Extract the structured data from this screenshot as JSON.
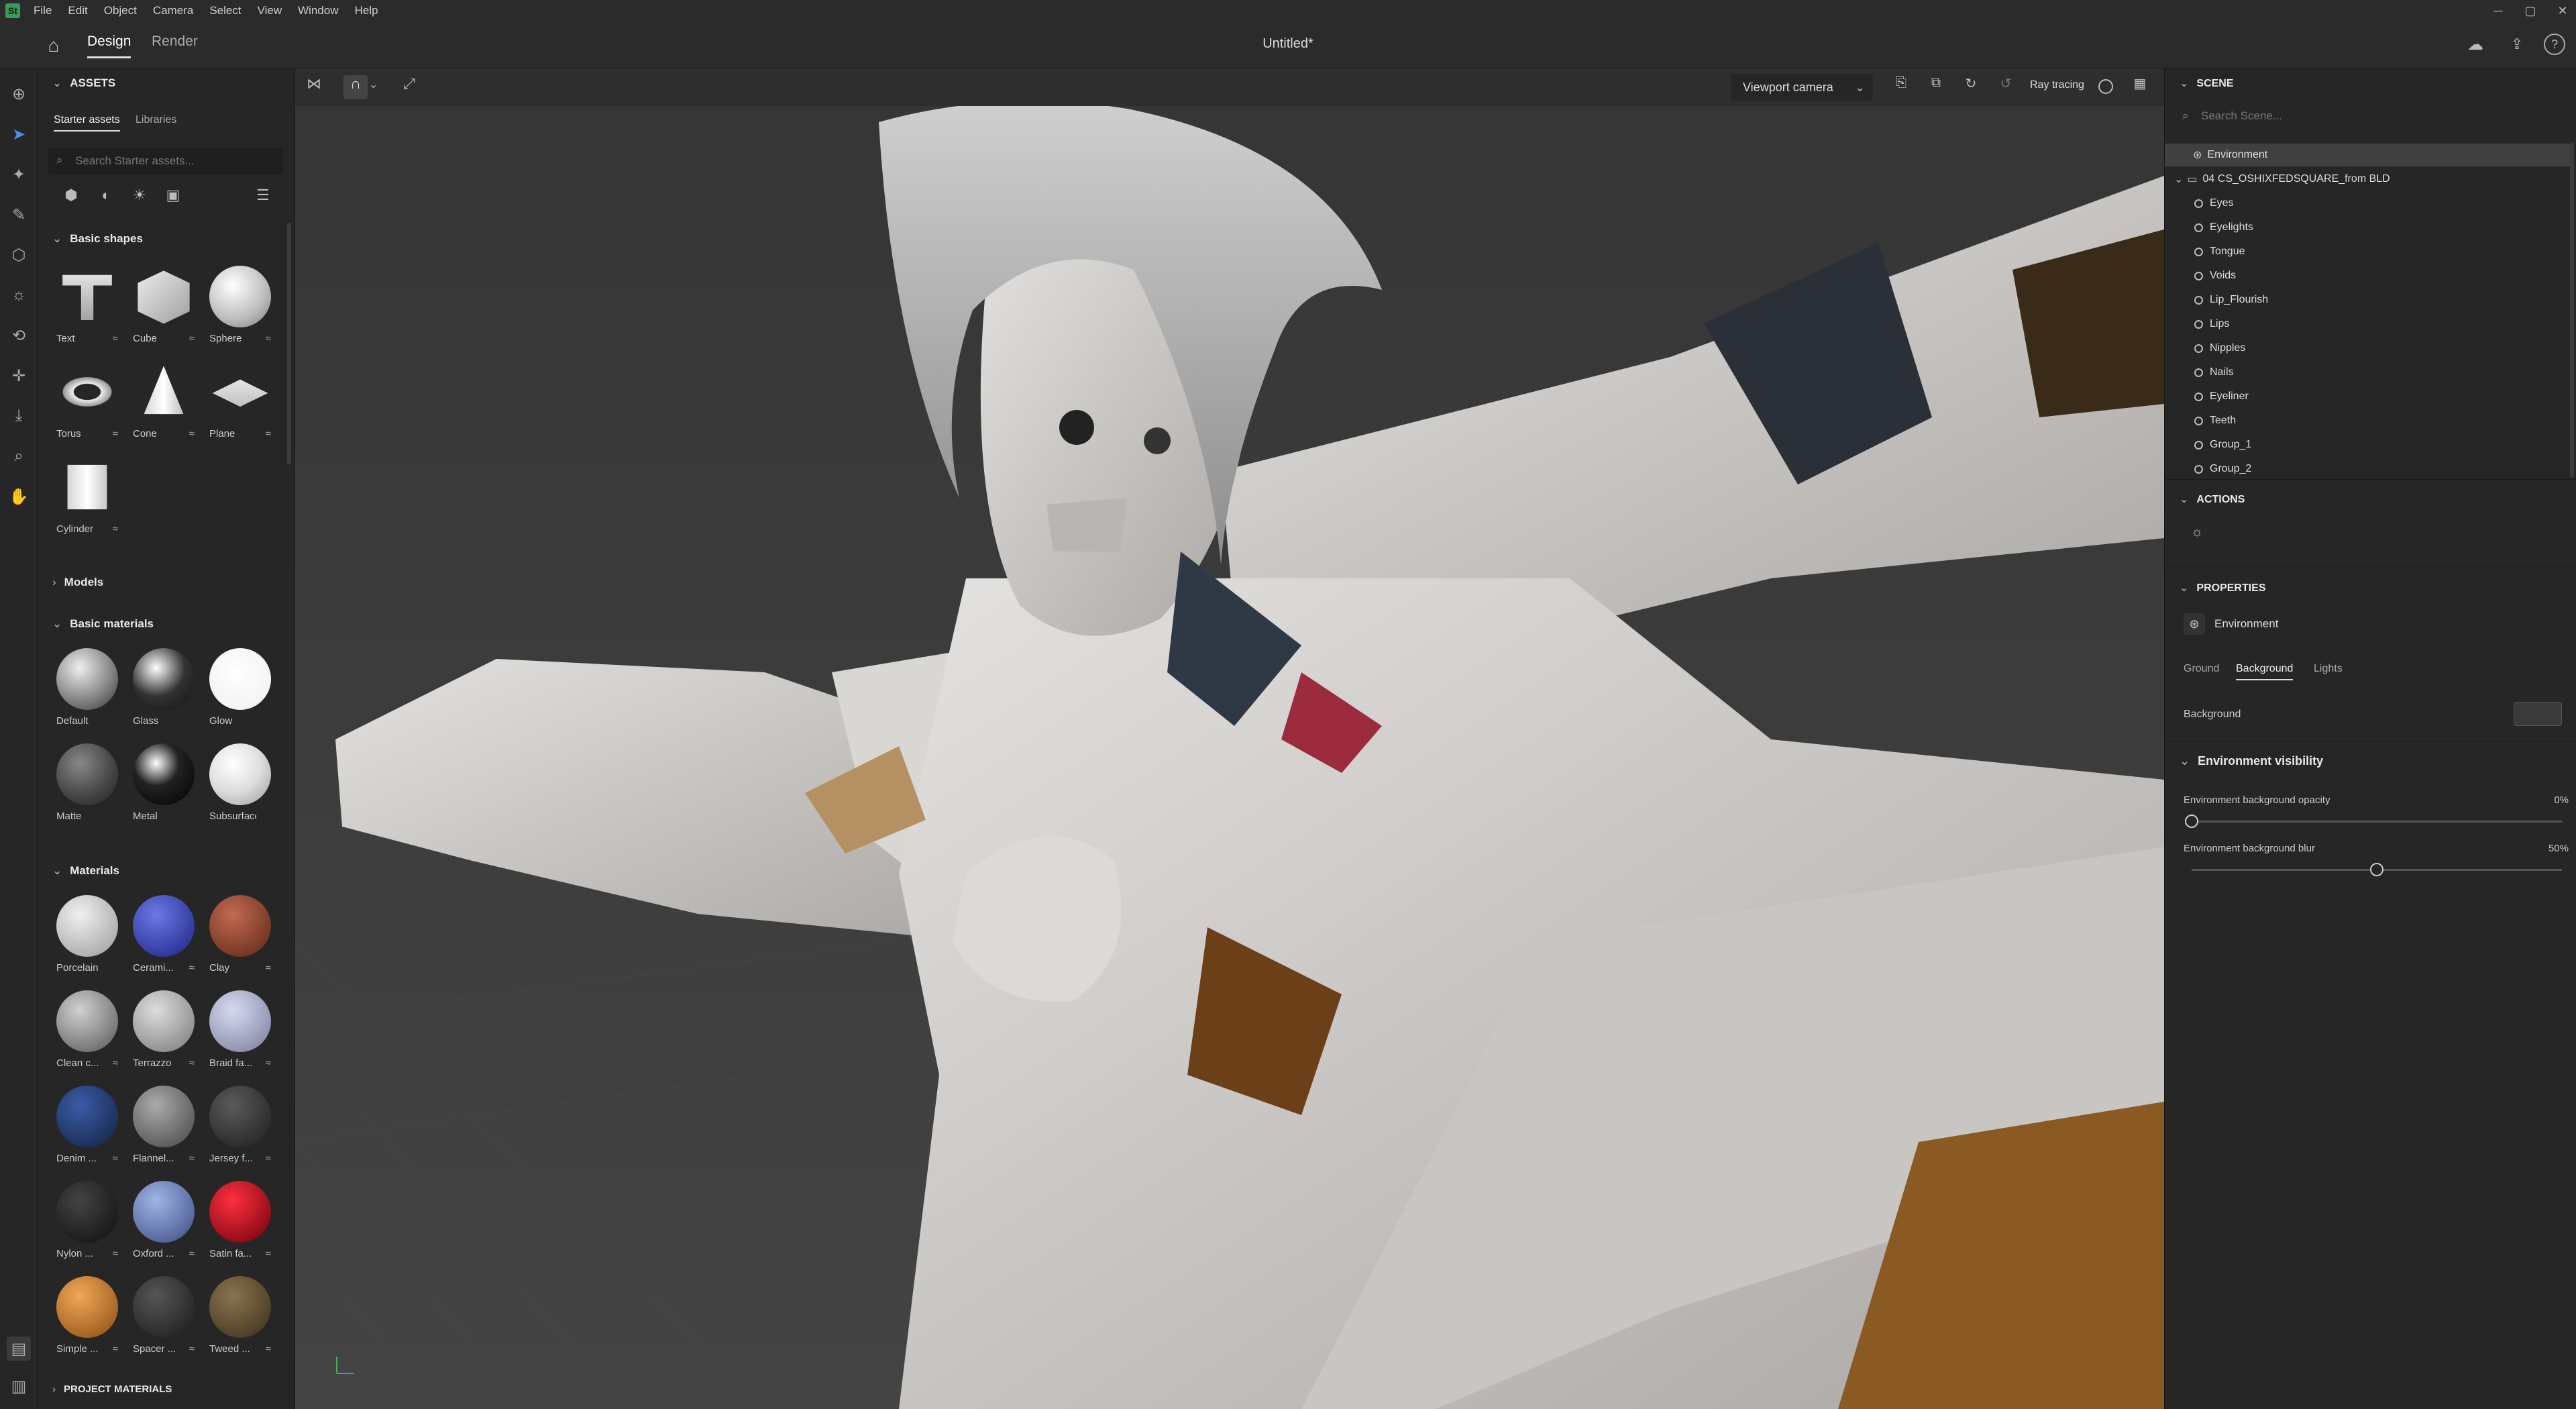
{
  "menubar": {
    "items": [
      "File",
      "Edit",
      "Object",
      "Camera",
      "Select",
      "View",
      "Window",
      "Help"
    ]
  },
  "topbar": {
    "home_icon": "home-icon",
    "tabs": [
      "Design",
      "Render"
    ],
    "active_tab": "Design",
    "document_title": "Untitled*"
  },
  "toolrail": {
    "icons": [
      "add-icon",
      "select-icon",
      "magic-select-icon",
      "paint-icon",
      "object-icon",
      "sample-icon",
      "transform-icon",
      "move-icon",
      "drop-to-ground-icon",
      "zoom-icon",
      "pan-icon"
    ],
    "bottom_icons": [
      "asset-panel-icon",
      "library-panel-icon"
    ]
  },
  "assets": {
    "title": "ASSETS",
    "tabs": [
      "Starter assets",
      "Libraries"
    ],
    "search_placeholder": "Search Starter assets...",
    "filter_icons": [
      "models-filter-icon",
      "materials-filter-icon",
      "lights-filter-icon",
      "images-filter-icon",
      "list-view-icon"
    ],
    "basic_shapes": {
      "title": "Basic shapes",
      "items": [
        "Text",
        "Cube",
        "Sphere",
        "Torus",
        "Cone",
        "Plane",
        "Cylinder"
      ]
    },
    "models": {
      "title": "Models"
    },
    "basic_materials": {
      "title": "Basic materials",
      "items": [
        "Default",
        "Glass",
        "Glow",
        "Matte",
        "Metal",
        "Subsurface"
      ]
    },
    "materials": {
      "title": "Materials",
      "items": [
        "Porcelain",
        "Cerami...",
        "Clay",
        "Clean c...",
        "Terrazzo",
        "Braid fa...",
        "Denim ...",
        "Flannel...",
        "Jersey f...",
        "Nylon ...",
        "Oxford ...",
        "Satin fa...",
        "Simple ...",
        "Spacer ...",
        "Tweed ..."
      ]
    },
    "project_materials": {
      "title": "PROJECT MATERIALS"
    }
  },
  "viewport_toolbar": {
    "camera_select": "Viewport camera",
    "ray_tracing_label": "Ray tracing"
  },
  "scene": {
    "title": "SCENE",
    "search_placeholder": "Search Scene...",
    "environment": "Environment",
    "group": "04 CS_OSHIXFEDSQUARE_from BLD",
    "children": [
      "Eyes",
      "Eyelights",
      "Tongue",
      "Voids",
      "Lip_Flourish",
      "Lips",
      "Nipples",
      "Nails",
      "Eyeliner",
      "Teeth",
      "Group_1",
      "Group_2"
    ]
  },
  "actions": {
    "title": "ACTIONS"
  },
  "properties": {
    "title": "PROPERTIES",
    "object": "Environment",
    "tabs": [
      "Ground",
      "Background",
      "Lights"
    ],
    "active_tab": "Background",
    "background_label": "Background",
    "visibility_title": "Environment visibility",
    "opacity_label": "Environment background opacity",
    "opacity_value": "0%",
    "opacity_fraction": 0,
    "blur_label": "Environment background blur",
    "blur_value": "50%",
    "blur_fraction": 0.5
  }
}
